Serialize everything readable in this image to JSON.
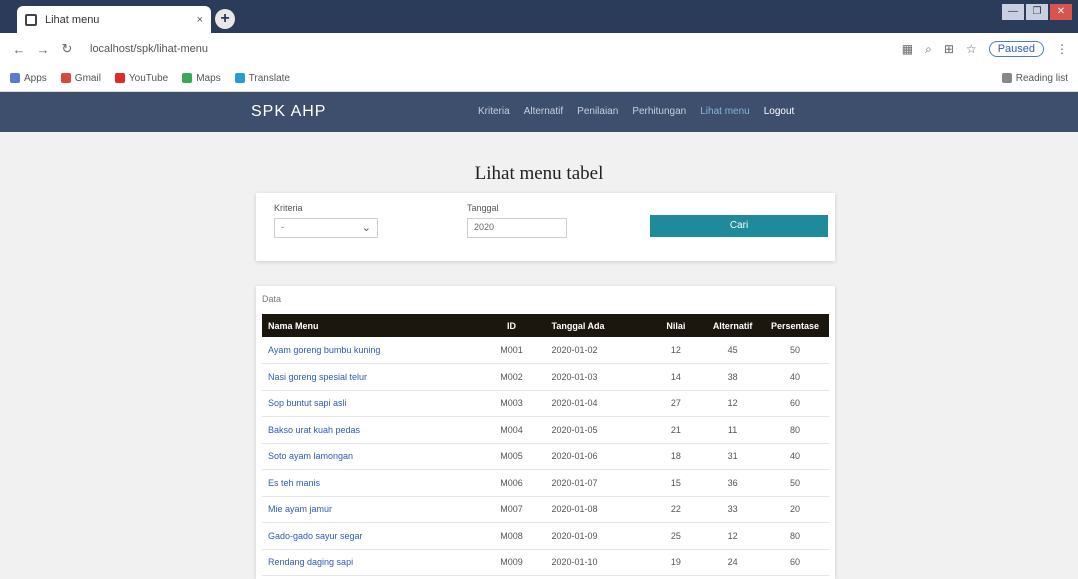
{
  "browser": {
    "tab_title": "Lihat menu",
    "tab_close": "×",
    "new_tab": "+",
    "url": "localhost/spk/lihat-menu",
    "profile": "Paused",
    "bookmarks": [
      "Apps",
      "Gmail",
      "YouTube",
      "Maps",
      "Translate"
    ],
    "bookmarks_right": "Reading list",
    "nav_back": "←",
    "nav_forward": "→",
    "nav_reload": "↻",
    "win_min": "—",
    "win_max": "❐",
    "win_close": "✕"
  },
  "navbar": {
    "brand": "SPK AHP",
    "menu": [
      "Kriteria",
      "Alternatif",
      "Penilaian",
      "Perhitungan",
      "Lihat menu",
      "Logout"
    ]
  },
  "page": {
    "title": "Lihat menu tabel",
    "filter": {
      "label1": "Kriteria",
      "select_value": "-",
      "label2": "Tanggal",
      "input_value": "2020",
      "button": "Cari"
    },
    "card_label": "Data",
    "table": {
      "headers": [
        "Nama Menu",
        "ID",
        "Tanggal Ada",
        "Nilai",
        "Alternatif",
        "Persentase"
      ],
      "rows": [
        [
          "Ayam goreng bumbu kuning",
          "M001",
          "2020-01-02",
          "12",
          "45",
          "50"
        ],
        [
          "Nasi goreng spesial telur",
          "M002",
          "2020-01-03",
          "14",
          "38",
          "40"
        ],
        [
          "Sop buntut sapi asli",
          "M003",
          "2020-01-04",
          "27",
          "12",
          "60"
        ],
        [
          "Bakso urat kuah pedas",
          "M004",
          "2020-01-05",
          "21",
          "11",
          "80"
        ],
        [
          "Soto ayam lamongan",
          "M005",
          "2020-01-06",
          "18",
          "31",
          "40"
        ],
        [
          "Es teh manis",
          "M006",
          "2020-01-07",
          "15",
          "36",
          "50"
        ],
        [
          "Mie ayam jamur",
          "M007",
          "2020-01-08",
          "22",
          "33",
          "20"
        ],
        [
          "Gado-gado sayur segar",
          "M008",
          "2020-01-09",
          "25",
          "12",
          "80"
        ],
        [
          "Rendang daging sapi",
          "M009",
          "2020-01-10",
          "19",
          "24",
          "60"
        ]
      ]
    }
  },
  "colors": {
    "navbar": "#3d4f6d",
    "button": "#1f8a99",
    "table_header": "#1b160e"
  }
}
